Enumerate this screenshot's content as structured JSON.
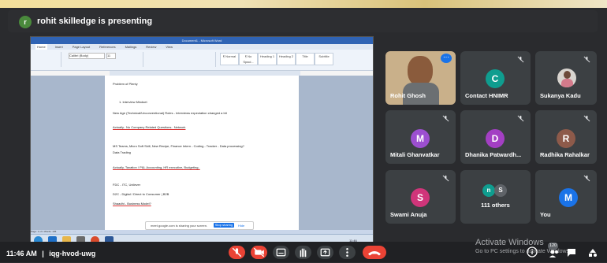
{
  "presenter": {
    "initial": "r",
    "banner": "rohit skilledge is presenting"
  },
  "shared_window": {
    "title": "Document1 - Microsoft Word",
    "tabs": [
      "Home",
      "Insert",
      "Page Layout",
      "References",
      "Mailings",
      "Review",
      "View"
    ],
    "font_name": "Calibri (Body)",
    "font_size": "11",
    "styles": [
      "¶ Normal",
      "¶ No Spaci...",
      "Heading 1",
      "Heading 2",
      "Title",
      "Subtitle"
    ],
    "doc_lines": [
      "Problem of Plenty",
      "1.   Interview Mindset",
      "New Age (Technical/Unconventional) Roles - Interviews expectation changed a bit",
      "Actually.. No Company Related Questions.. Network",
      "MS Teams, Micro Soft Skill, New Recipe, Finance Intern - Coding - Tracker - Data processing?",
      "Data Trading",
      "Actually, Taxation / P&L Accounting, HR executive, Budgeting..",
      "FDC - ITC, Unilever",
      "D2C - Digital / Direct to Consumer | B2B",
      "Shaadhi - Business Model?"
    ],
    "status": "Page: 1 of 1   Words: 105",
    "share_toast": "meet.google.com is sharing your screen.",
    "stop_sharing": "Stop sharing",
    "hide": "Hide",
    "clock": "11:46"
  },
  "participants": [
    {
      "name": "Rohit Ghosh",
      "has_video": true
    },
    {
      "name": "Contact HNIMR",
      "initial": "C",
      "color": "#0f9d8f"
    },
    {
      "name": "Sukanya Kadu",
      "has_photo": true
    },
    {
      "name": "Mitali Ghanvatkar",
      "initial": "M",
      "color": "#9c4fd0"
    },
    {
      "name": "Dhanika Patwardh...",
      "initial": "D",
      "color": "#a33fc3"
    },
    {
      "name": "Radhika Rahalkar",
      "initial": "R",
      "color": "#8d5a4a"
    },
    {
      "name": "Swami Anuja",
      "initial": "S",
      "color": "#d0357a"
    },
    {
      "name": "111 others",
      "initials": [
        "n",
        "S"
      ]
    },
    {
      "name": "You",
      "initial": "M",
      "color": "#1a73e8"
    }
  ],
  "meeting": {
    "time": "11:46 AM",
    "code": "iqg-hvod-uwg",
    "separator": "|"
  },
  "overlay": {
    "title": "Activate Windows",
    "subtitle": "Go to PC settings to activate Windows.",
    "badge": "120"
  },
  "colors": {
    "end_call": "#ea4335",
    "muted": "#ea4335",
    "tile_bg": "#3c4043"
  }
}
